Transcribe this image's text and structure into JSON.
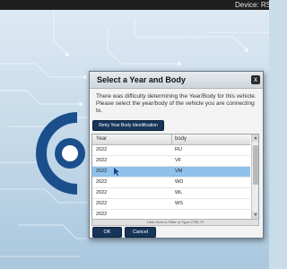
{
  "topbar": {
    "device_label": "Device:  RS"
  },
  "dialog": {
    "title": "Select a Year and Body",
    "close_label": "x",
    "message": "There was difficulty determining the Year/Body for this vehicle. Please select the year/body of the vehicle you are connecting to.",
    "retry_label": "Retry Year Body Identification",
    "columns": {
      "year": "Year",
      "body": "body"
    },
    "rows": [
      {
        "year": "2022",
        "body": "RU"
      },
      {
        "year": "2022",
        "body": "VF"
      },
      {
        "year": "2022",
        "body": "VM"
      },
      {
        "year": "2022",
        "body": "WD"
      },
      {
        "year": "2022",
        "body": "WL"
      },
      {
        "year": "2022",
        "body": "WS"
      },
      {
        "year": "2022",
        "body": ""
      }
    ],
    "selected_row": 2,
    "filter_label": "Click Here to Filter or Type CTRL+F",
    "ok_label": "OK",
    "cancel_label": "Cancel"
  },
  "colors": {
    "button": "#17355a",
    "selected_row": "#8fc1ea",
    "topbar": "#1e1e1e"
  }
}
